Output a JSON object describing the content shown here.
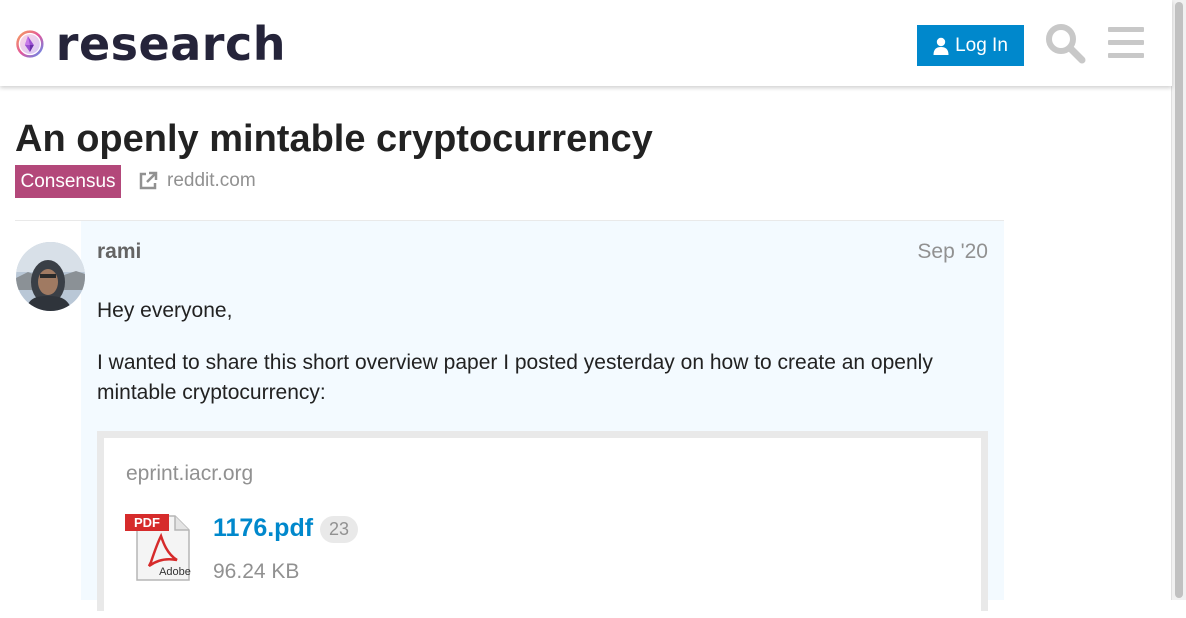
{
  "header": {
    "logo_text": "research",
    "login_label": "Log In"
  },
  "topic": {
    "title": "An openly mintable cryptocurrency",
    "category": "Consensus",
    "external_link": "reddit.com"
  },
  "post": {
    "username": "rami",
    "date": "Sep '20",
    "paragraphs": [
      "Hey everyone,",
      "I wanted to share this short overview paper I posted yesterday on how to create an openly mintable cryptocurrency:"
    ],
    "onebox": {
      "source": "eprint.iacr.org",
      "file_name": "1176.pdf",
      "click_count": "23",
      "file_size": "96.24 KB",
      "icon": "pdf-icon",
      "icon_labels": [
        "PDF",
        "Adobe"
      ]
    }
  },
  "colors": {
    "accent": "#0088cc",
    "category": "#b3487a",
    "post_background": "#f3faff"
  },
  "icons": [
    "logo-icon",
    "user-icon",
    "search-icon",
    "hamburger-menu-icon",
    "external-link-icon",
    "pdf-icon"
  ]
}
